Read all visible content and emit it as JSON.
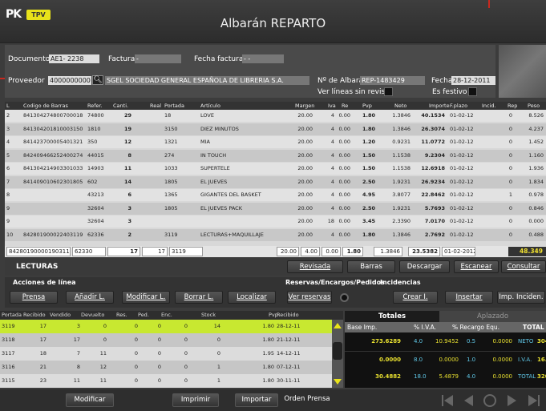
{
  "app": {
    "logo": "PK",
    "badge": "TPV",
    "title": "Albarán REPARTO"
  },
  "header": {
    "documento_label": "Documento",
    "documento_value": "AE1- 2238",
    "factura_label": "Factura",
    "factura_value": "-",
    "fecha_factura_label": "Fecha factura",
    "fecha_factura_value": "- -",
    "proveedor_label": "Proveedor",
    "proveedor_code": "4000000000",
    "proveedor_name": "SGEL SOCIEDAD GENERAL ESPAÑOLA DE LIBRERIA S.A.",
    "num_albaran_label": "Nº de Albarán",
    "num_albaran_value": "REP-1483429",
    "fecha_label": "Fecha",
    "fecha_value": "28-12-2011",
    "ver_lineas_label": "Ver líneas sin revisar",
    "es_festivo_label": "Es festivo"
  },
  "grid": {
    "columns": [
      "L",
      "Codigo de Barras",
      "Refer.",
      "Canti.",
      "Real",
      "Portada",
      "Artículo",
      "Margen",
      "Iva",
      "Re",
      "Pvp",
      "Neto",
      "Importe",
      "F.plazo",
      "Incid.",
      "Rep",
      "Peso"
    ],
    "rows": [
      {
        "l": "2",
        "codigo": "841304274800700018",
        "ref": "74800",
        "canti": "29",
        "real": "",
        "portada": "18",
        "articulo": "LOVE",
        "margen": "20.00",
        "iva": "4",
        "re": "0.00",
        "pvp": "1.80",
        "neto": "1.3846",
        "importe": "40.1534",
        "fplazo": "01-02-12",
        "incid": "",
        "rep": "0",
        "peso": "8.526"
      },
      {
        "l": "3",
        "codigo": "841304201810003150",
        "ref": "1810",
        "canti": "19",
        "real": "",
        "portada": "3150",
        "articulo": "DIEZ MINUTOS",
        "margen": "20.00",
        "iva": "4",
        "re": "0.00",
        "pvp": "1.80",
        "neto": "1.3846",
        "importe": "26.3074",
        "fplazo": "01-02-12",
        "incid": "",
        "rep": "0",
        "peso": "4.237"
      },
      {
        "l": "4",
        "codigo": "841423700005401321",
        "ref": "350",
        "canti": "12",
        "real": "",
        "portada": "1321",
        "articulo": "MIA",
        "margen": "20.00",
        "iva": "4",
        "re": "0.00",
        "pvp": "1.20",
        "neto": "0.9231",
        "importe": "11.0772",
        "fplazo": "01-02-12",
        "incid": "",
        "rep": "0",
        "peso": "1.452"
      },
      {
        "l": "5",
        "codigo": "842409466252400274",
        "ref": "44015",
        "canti": "8",
        "real": "",
        "portada": "274",
        "articulo": "IN TOUCH",
        "margen": "20.00",
        "iva": "4",
        "re": "0.00",
        "pvp": "1.50",
        "neto": "1.1538",
        "importe": "9.2304",
        "fplazo": "01-02-12",
        "incid": "",
        "rep": "0",
        "peso": "1.160"
      },
      {
        "l": "6",
        "codigo": "841304214903301033",
        "ref": "14903",
        "canti": "11",
        "real": "",
        "portada": "1033",
        "articulo": "SUPERTELE",
        "margen": "20.00",
        "iva": "4",
        "re": "0.00",
        "pvp": "1.50",
        "neto": "1.1538",
        "importe": "12.6918",
        "fplazo": "01-02-12",
        "incid": "",
        "rep": "0",
        "peso": "1.936"
      },
      {
        "l": "7",
        "codigo": "841409010602301805",
        "ref": "602",
        "canti": "14",
        "real": "",
        "portada": "1805",
        "articulo": "EL JUEVES",
        "margen": "20.00",
        "iva": "4",
        "re": "0.00",
        "pvp": "2.50",
        "neto": "1.9231",
        "importe": "26.9234",
        "fplazo": "01-02-12",
        "incid": "",
        "rep": "0",
        "peso": "1.834"
      },
      {
        "l": "8",
        "codigo": "",
        "ref": "43213",
        "canti": "6",
        "real": "",
        "portada": "1365",
        "articulo": "GIGANTES DEL BASKET",
        "margen": "20.00",
        "iva": "4",
        "re": "0.00",
        "pvp": "4.95",
        "neto": "3.8077",
        "importe": "22.8462",
        "fplazo": "01-02-12",
        "incid": "",
        "rep": "1",
        "peso": "0.978"
      },
      {
        "l": "9",
        "codigo": "",
        "ref": "32604",
        "canti": "3",
        "real": "",
        "portada": "1805",
        "articulo": "EL JUEVES PACK",
        "margen": "20.00",
        "iva": "4",
        "re": "0.00",
        "pvp": "2.50",
        "neto": "1.9231",
        "importe": "5.7693",
        "fplazo": "01-02-12",
        "incid": "",
        "rep": "0",
        "peso": "0.846"
      },
      {
        "l": "9",
        "codigo": "",
        "ref": "32604",
        "canti": "3",
        "real": "",
        "portada": "",
        "articulo": "",
        "margen": "20.00",
        "iva": "18",
        "re": "0.00",
        "pvp": "3.45",
        "neto": "2.3390",
        "importe": "7.0170",
        "fplazo": "01-02-12",
        "incid": "",
        "rep": "0",
        "peso": "0.000"
      },
      {
        "l": "10",
        "codigo": "842801900022403119",
        "ref": "62336",
        "canti": "2",
        "real": "",
        "portada": "3119",
        "articulo": "LECTURAS+MAQUILLAJE",
        "margen": "20.00",
        "iva": "4",
        "re": "0.00",
        "pvp": "1.80",
        "neto": "1.3846",
        "importe": "2.7692",
        "fplazo": "01-02-12",
        "incid": "",
        "rep": "0",
        "peso": "0.488"
      }
    ]
  },
  "current": {
    "codigo": "842801900001903119",
    "ref": "62330",
    "canti": "17",
    "real": "17",
    "portada": "3119",
    "articulo": "",
    "margen": "20.00",
    "iva": "4.00",
    "re": "0.00",
    "pvp": "1.80",
    "neto": "1.3846",
    "importe": "23.5382",
    "fplazo": "01-02-2012",
    "total": "48.349"
  },
  "lecturas": {
    "title": "LECTURAS",
    "revisada": "Revisada",
    "barras": "Barras",
    "descargar": "Descargar",
    "escanear": "Escanear",
    "consultar": "Consultar"
  },
  "acciones": {
    "title": "Acciones de línea",
    "prensa": "Prensa",
    "anadir": "Añadir L.",
    "modificar": "Modificar L.",
    "borrar": "Borrar L.",
    "localizar": "Localizar",
    "reservas_title": "Reservas/Encargos/Pedidos",
    "ver_reservas": "Ver reservas",
    "incidencias_title": "Incidencias",
    "crear": "Crear I.",
    "insertar": "Insertar",
    "imp_inciden": "Imp. Inciden."
  },
  "lower_grid": {
    "columns": [
      "Portada",
      "Recibido",
      "Vendido",
      "Devuelto",
      "Res.",
      "Ped.",
      "Enc.",
      "Stock",
      "Pvp",
      "Recibido"
    ],
    "rows": [
      {
        "portada": "3119",
        "recibido": "17",
        "vendido": "3",
        "devuelto": "0",
        "res": "0",
        "ped": "0",
        "enc": "0",
        "stock": "14",
        "pvp": "1.80",
        "fecha": "28-12-11"
      },
      {
        "portada": "3118",
        "recibido": "17",
        "vendido": "17",
        "devuelto": "0",
        "res": "0",
        "ped": "0",
        "enc": "0",
        "stock": "0",
        "pvp": "1.80",
        "fecha": "21-12-11"
      },
      {
        "portada": "3117",
        "recibido": "18",
        "vendido": "7",
        "devuelto": "11",
        "res": "0",
        "ped": "0",
        "enc": "0",
        "stock": "0",
        "pvp": "1.95",
        "fecha": "14-12-11"
      },
      {
        "portada": "3116",
        "recibido": "21",
        "vendido": "8",
        "devuelto": "12",
        "res": "0",
        "ped": "0",
        "enc": "0",
        "stock": "1",
        "pvp": "1.80",
        "fecha": "07-12-11"
      },
      {
        "portada": "3115",
        "recibido": "23",
        "vendido": "11",
        "devuelto": "11",
        "res": "0",
        "ped": "0",
        "enc": "0",
        "stock": "1",
        "pvp": "1.80",
        "fecha": "30-11-11"
      }
    ]
  },
  "totals": {
    "tab_totales": "Totales",
    "tab_aplazado": "Aplazado",
    "columns": [
      "Base Imp.",
      "% I.V.A.",
      "% Recargo Equ.",
      "TOTAL"
    ],
    "rows": [
      {
        "base": "273.6289",
        "iva_pct": "4.0",
        "iva_val": "10.9452",
        "re_pct": "0.5",
        "re_val": "0.0000",
        "label": "NETO",
        "total": "304.117"
      },
      {
        "base": "0.0000",
        "iva_pct": "8.0",
        "iva_val": "0.0000",
        "re_pct": "1.0",
        "re_val": "0.0000",
        "label": "I.V.A.",
        "total": "16.431"
      },
      {
        "base": "30.4882",
        "iva_pct": "18.0",
        "iva_val": "5.4879",
        "re_pct": "4.0",
        "re_val": "0.0000",
        "label": "TOTAL",
        "total": "320.550"
      }
    ]
  },
  "bottom": {
    "modificar": "Modificar",
    "imprimir": "Imprimir",
    "importar": "Importar",
    "orden_prensa": "Orden Prensa"
  },
  "colors": {
    "accent_yellow": "#e8e21a",
    "selected_row": "#c8e830",
    "total_text": "#f0e030",
    "cyan": "#60c8e8"
  }
}
